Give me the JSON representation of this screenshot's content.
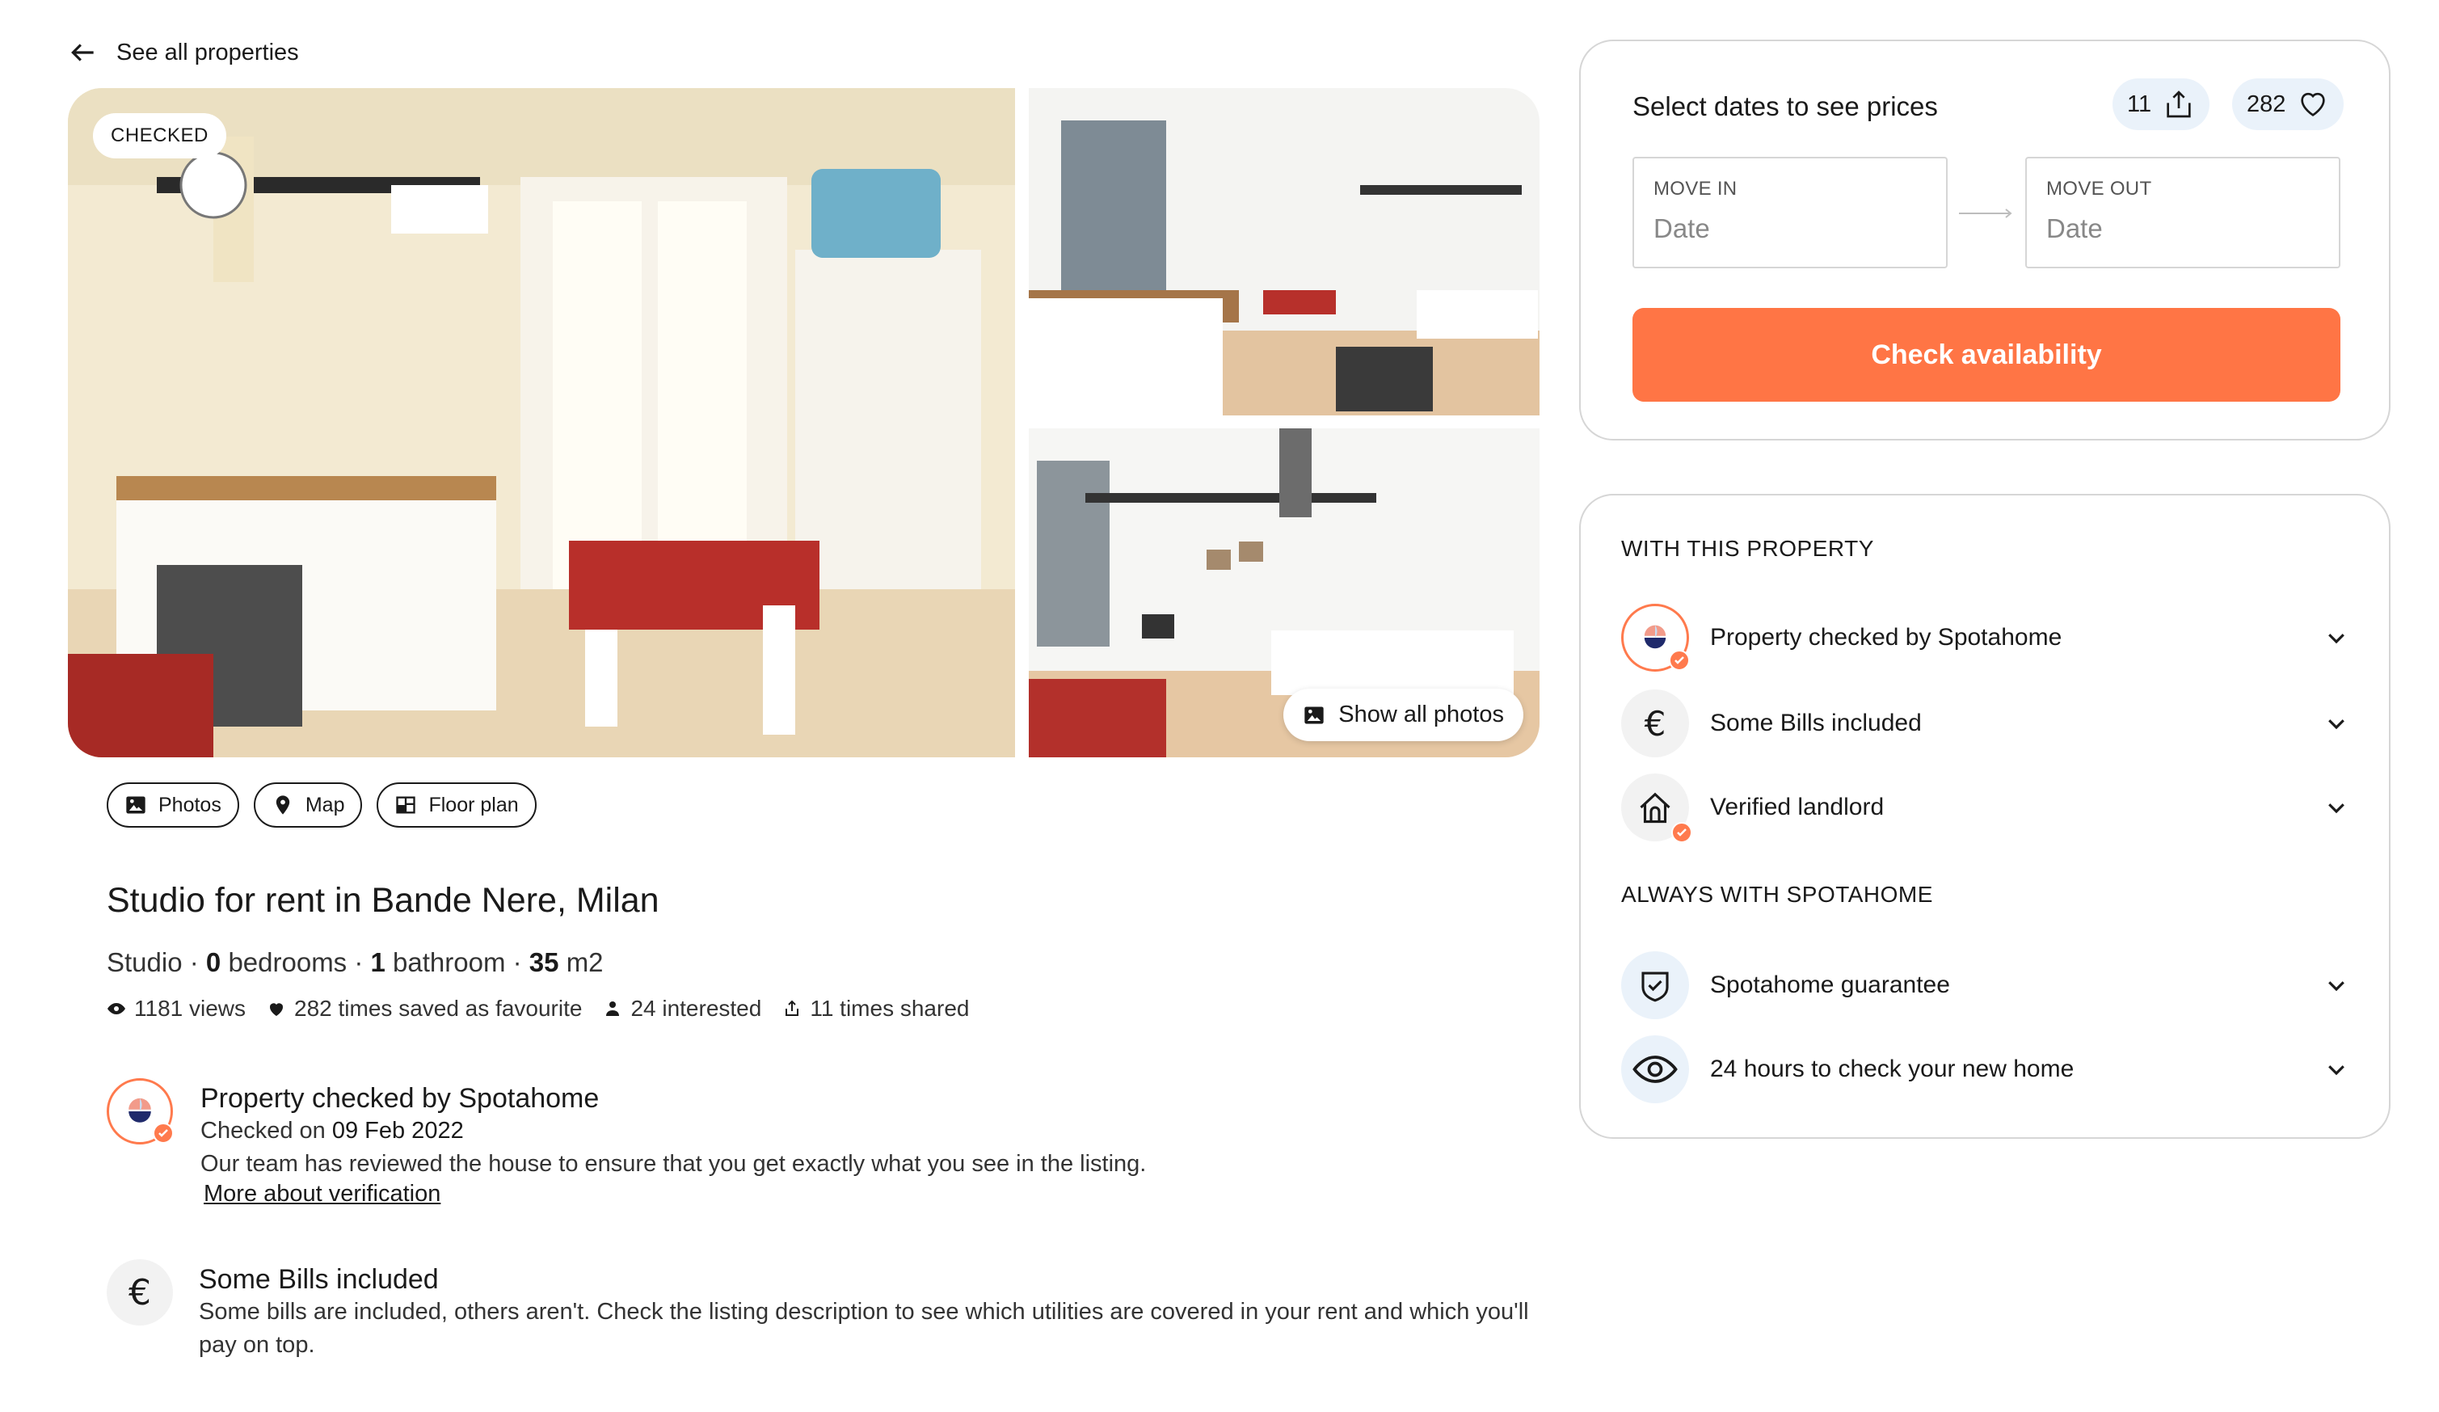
{
  "nav": {
    "back_label": "See all properties"
  },
  "gallery": {
    "badge": "CHECKED",
    "show_all_label": "Show all photos"
  },
  "media_tabs": [
    {
      "label": "Photos",
      "icon": "image-icon"
    },
    {
      "label": "Map",
      "icon": "map-pin-icon"
    },
    {
      "label": "Floor plan",
      "icon": "floor-plan-icon"
    }
  ],
  "listing": {
    "title": "Studio for rent in Bande Nere, Milan",
    "type": "Studio",
    "bedrooms_count": "0",
    "bedrooms_label": "bedrooms",
    "bathrooms_count": "1",
    "bathrooms_label": "bathroom",
    "size_value": "35",
    "size_unit": "m2",
    "stats": {
      "views": "1181 views",
      "favourites": "282 times saved as favourite",
      "interested": "24 interested",
      "shared": "11 times shared"
    }
  },
  "features": {
    "checked": {
      "title": "Property checked by Spotahome",
      "checked_prefix": "Checked on",
      "checked_date": "09 Feb 2022",
      "body": "Our team has reviewed the house to ensure that you get exactly what you see in the listing.",
      "link": "More about verification"
    },
    "bills": {
      "title": "Some Bills included",
      "body": "Some bills are included, others aren't. Check the listing description to see which utilities are covered in your rent and which you'll pay on top."
    }
  },
  "booking": {
    "title": "Select dates to see prices",
    "share_count": "11",
    "favourite_count": "282",
    "move_in_label": "MOVE IN",
    "move_in_placeholder": "Date",
    "move_out_label": "MOVE OUT",
    "move_out_placeholder": "Date",
    "cta": "Check availability"
  },
  "perks": {
    "with_property_heading": "WITH THIS PROPERTY",
    "with_property": [
      {
        "label": "Property checked by Spotahome",
        "icon": "spotahome-check-icon"
      },
      {
        "label": "Some Bills included",
        "icon": "euro-icon"
      },
      {
        "label": "Verified landlord",
        "icon": "house-icon"
      }
    ],
    "always_heading": "ALWAYS WITH SPOTAHOME",
    "always": [
      {
        "label": "Spotahome guarantee",
        "icon": "shield-icon"
      },
      {
        "label": "24 hours to check your new home",
        "icon": "eye-icon"
      }
    ]
  },
  "colors": {
    "accent": "#FF7545",
    "pill_bg": "#EAF2FA",
    "border": "#D6D6D6"
  }
}
